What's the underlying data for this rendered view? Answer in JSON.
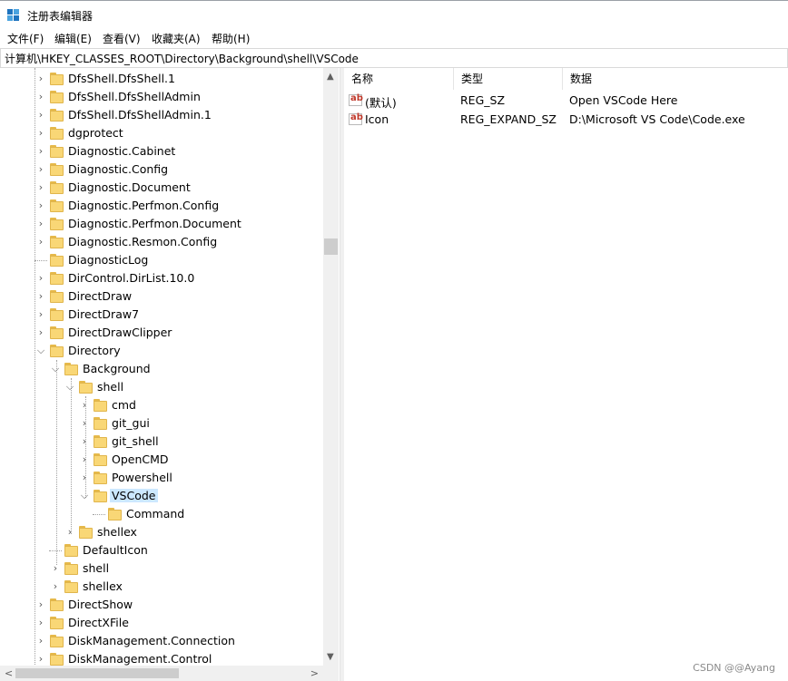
{
  "window": {
    "title": "注册表编辑器",
    "app_icon": "registry-editor-icon"
  },
  "menu": [
    "文件(F)",
    "编辑(E)",
    "查看(V)",
    "收藏夹(A)",
    "帮助(H)"
  ],
  "address": "计算机\\HKEY_CLASSES_ROOT\\Directory\\Background\\shell\\VSCode",
  "tree": [
    {
      "label": "DfsShell.DfsShell.1",
      "chevron": "right"
    },
    {
      "label": "DfsShell.DfsShellAdmin",
      "chevron": "right"
    },
    {
      "label": "DfsShell.DfsShellAdmin.1",
      "chevron": "right"
    },
    {
      "label": "dgprotect",
      "chevron": "right"
    },
    {
      "label": "Diagnostic.Cabinet",
      "chevron": "right"
    },
    {
      "label": "Diagnostic.Config",
      "chevron": "right"
    },
    {
      "label": "Diagnostic.Document",
      "chevron": "right"
    },
    {
      "label": "Diagnostic.Perfmon.Config",
      "chevron": "right"
    },
    {
      "label": "Diagnostic.Perfmon.Document",
      "chevron": "right"
    },
    {
      "label": "Diagnostic.Resmon.Config",
      "chevron": "right"
    },
    {
      "label": "DiagnosticLog",
      "chevron": "none"
    },
    {
      "label": "DirControl.DirList.10.0",
      "chevron": "right"
    },
    {
      "label": "DirectDraw",
      "chevron": "right"
    },
    {
      "label": "DirectDraw7",
      "chevron": "right"
    },
    {
      "label": "DirectDrawClipper",
      "chevron": "right"
    },
    {
      "label": "Directory",
      "chevron": "down"
    },
    {
      "label": "Background",
      "chevron": "down"
    },
    {
      "label": "shell",
      "chevron": "down"
    },
    {
      "label": "cmd",
      "chevron": "right"
    },
    {
      "label": "git_gui",
      "chevron": "right"
    },
    {
      "label": "git_shell",
      "chevron": "right"
    },
    {
      "label": "OpenCMD",
      "chevron": "right"
    },
    {
      "label": "Powershell",
      "chevron": "right"
    },
    {
      "label": "VSCode",
      "chevron": "down",
      "selected": true
    },
    {
      "label": "Command",
      "chevron": "none"
    },
    {
      "label": "shellex",
      "chevron": "right"
    },
    {
      "label": "DefaultIcon",
      "chevron": "none"
    },
    {
      "label": "shell",
      "chevron": "right"
    },
    {
      "label": "shellex",
      "chevron": "right"
    },
    {
      "label": "DirectShow",
      "chevron": "right"
    },
    {
      "label": "DirectXFile",
      "chevron": "right"
    },
    {
      "label": "DiskManagement.Connection",
      "chevron": "right"
    },
    {
      "label": "DiskManagement.Control",
      "chevron": "right"
    }
  ],
  "values": {
    "columns": [
      "名称",
      "类型",
      "数据"
    ],
    "rows": [
      {
        "name": "(默认)",
        "type": "REG_SZ",
        "data": "Open VSCode Here",
        "icon": "ab-string-icon"
      },
      {
        "name": "Icon",
        "type": "REG_EXPAND_SZ",
        "data": "D:\\Microsoft VS Code\\Code.exe",
        "icon": "ab-string-icon"
      }
    ]
  },
  "watermark": "CSDN @@Ayang",
  "colors": {
    "selection": "#cce8ff",
    "folder": "#f9d776"
  }
}
